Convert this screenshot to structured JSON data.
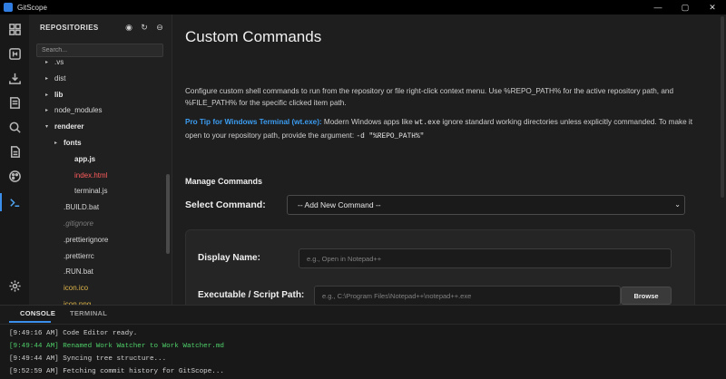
{
  "window": {
    "title": "GitScope",
    "controls": [
      "—",
      "▢",
      "✕"
    ]
  },
  "activity_bar": {
    "items": [
      {
        "icon": "grid-icon"
      },
      {
        "icon": "git-icon"
      },
      {
        "icon": "download-icon"
      },
      {
        "icon": "book-icon"
      },
      {
        "icon": "search-icon"
      },
      {
        "icon": "document-icon"
      },
      {
        "icon": "palette-icon"
      },
      {
        "icon": "terminal-icon",
        "active": true
      },
      {
        "icon": "gear-icon"
      }
    ]
  },
  "sidebar": {
    "title": "REPOSITORIES",
    "search_placeholder": "Search...",
    "tree": [
      {
        "label": ".vs",
        "chevron": "▸",
        "depth": 1,
        "style": ""
      },
      {
        "label": "dist",
        "chevron": "▸",
        "depth": 1,
        "style": ""
      },
      {
        "label": "lib",
        "chevron": "▸",
        "depth": 1,
        "style": "bold"
      },
      {
        "label": "node_modules",
        "chevron": "▸",
        "depth": 1,
        "style": ""
      },
      {
        "label": "renderer",
        "chevron": "▾",
        "depth": 1,
        "style": "red bold"
      },
      {
        "label": "fonts",
        "chevron": "▸",
        "depth": 2,
        "style": "bold"
      },
      {
        "label": "app.js",
        "chevron": "",
        "depth": 3,
        "style": "red bold"
      },
      {
        "label": "index.html",
        "chevron": "",
        "depth": 3,
        "style": "red"
      },
      {
        "label": "terminal.js",
        "chevron": "",
        "depth": 3,
        "style": ""
      },
      {
        "label": ".BUILD.bat",
        "chevron": "",
        "depth": 2,
        "style": ""
      },
      {
        "label": ".gitignore",
        "chevron": "",
        "depth": 2,
        "style": "dim"
      },
      {
        "label": ".prettierignore",
        "chevron": "",
        "depth": 2,
        "style": ""
      },
      {
        "label": ".prettierrc",
        "chevron": "",
        "depth": 2,
        "style": ""
      },
      {
        "label": ".RUN.bat",
        "chevron": "",
        "depth": 2,
        "style": ""
      },
      {
        "label": "icon.ico",
        "chevron": "",
        "depth": 2,
        "style": "yellow"
      },
      {
        "label": "icon.png",
        "chevron": "",
        "depth": 2,
        "style": "yellow"
      }
    ]
  },
  "main": {
    "title": "Custom Commands",
    "description": "Configure custom shell commands to run from the repository or file right-click context menu. Use %REPO_PATH% for the active repository path, and %FILE_PATH% for the specific clicked item path.",
    "tip": {
      "label": "Pro Tip for Windows Terminal (wt.exe):",
      "text_1": " Modern Windows apps like ",
      "code_1": "wt.exe",
      "text_2": " ignore standard working directories unless explicitly commanded. To make it open to your repository path, provide the argument: ",
      "code_2": "-d \"%REPO_PATH%\""
    },
    "section_title": "Manage Commands",
    "select_label": "Select Command:",
    "select_value": "-- Add New Command --",
    "display_name_label": "Display Name:",
    "display_name_placeholder": "e.g., Open in Notepad++",
    "exe_label": "Executable / Script Path:",
    "exe_placeholder": "e.g., C:\\Program Files\\Notepad++\\notepad++.exe",
    "browse_label": "Browse"
  },
  "panel": {
    "tabs": [
      "CONSOLE",
      "TERMINAL"
    ],
    "active_tab": "CONSOLE",
    "logs": [
      {
        "text": "[9:49:16 AM] Code Editor ready.",
        "level": "info"
      },
      {
        "text": "[9:49:44 AM] Renamed Work Watcher to Work Watcher.md",
        "level": "success"
      },
      {
        "text": "[9:49:44 AM] Syncing tree structure...",
        "level": "info"
      },
      {
        "text": "[9:52:59 AM] Fetching commit history for GitScope...",
        "level": "info"
      }
    ]
  }
}
